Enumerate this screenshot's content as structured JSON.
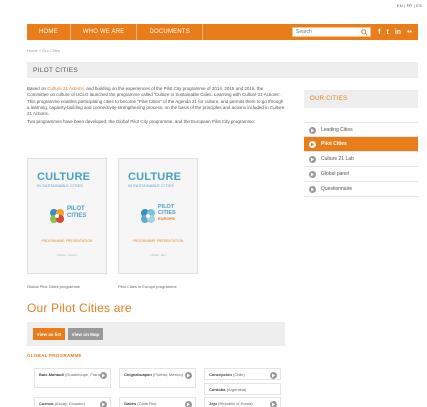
{
  "language_bar": "EN | FR | ES",
  "nav": {
    "items": [
      "HOME",
      "WHO WE ARE",
      "DOCUMENTS"
    ],
    "search_placeholder": "Search",
    "social": [
      "f",
      "t",
      "in",
      "••"
    ]
  },
  "breadcrumb": "Home > Our Cities",
  "page_title": "PILOT CITIES",
  "intro": {
    "p1_before": "Based on ",
    "p1_link": "Culture 21 Actions",
    "p1_after": ", and building on the experiences of the Pilot City programme of 2014, 2015 and 2016, the Committee on culture of UCLG launched the programme called 'Culture in Sustainable Cities. Learning with Culture 21 Actions'. This programme enables participating cities to become \"Pilot Cities\" of the Agenda 21 for culture, and permits them to go through a learning, capacity-building and connectivity-strengthening process, on the basis of the principles and actions included in Culture 21 Actions.",
    "p2": "Two programmes have been developed: the Global Pilot City programme, and the European Pilot City programme:"
  },
  "brochures": [
    {
      "title1": "CULTURE",
      "title2": "IN SUSTAINABLE CITIES",
      "logo_line1": "PILOT",
      "logo_line2": "CITIES",
      "logo_line3": "",
      "subtitle": "PROGRAMME PRESENTATION",
      "tiny": "UCLG · CGLU",
      "caption": "Global Pilot Cities programme",
      "colors": [
        "#3b8fc3",
        "#f2a02a",
        "#8cc04a",
        "#d9463c"
      ]
    },
    {
      "title1": "CULTURE",
      "title2": "IN SUSTAINABLE CITIES",
      "logo_line1": "PILOT",
      "logo_line2": "CITIES",
      "logo_line3": "EUROPE",
      "subtitle": "PROGRAMME PRESENTATION",
      "tiny": "UCLG · EU",
      "caption": "Pilot Cities in Europe programme",
      "colors": [
        "#3b8fc3",
        "#7bc4d8",
        "#5fa8d3",
        "#a4d3e8"
      ]
    }
  ],
  "sidebar": {
    "heading": "OUR CITIES",
    "items": [
      {
        "label": "Leading Cities",
        "active": false
      },
      {
        "label": "Pilot Cities",
        "active": true
      },
      {
        "label": "Culture 21 Lab",
        "active": false
      },
      {
        "label": "Global panel",
        "active": false
      },
      {
        "label": "Questionnaire",
        "active": false
      }
    ]
  },
  "section_title": "Our Pilot Cities are",
  "view_buttons": {
    "list": "View as list",
    "map": "View on Map"
  },
  "global_programme": "GLOBAL PROGRAMME",
  "cities": [
    {
      "name": "Baie-Mahault",
      "country": "(Guadeloupe, France)"
    },
    {
      "name": "Chignahuapan",
      "country": "(Puebla, Mexico)"
    },
    {
      "name": "Concepción",
      "country": "(Chile)"
    },
    {
      "name": "Córdoba",
      "country": "(Argentina)"
    },
    {
      "name": "Cuenca",
      "country": "(Azuay, Ecuador)"
    },
    {
      "name": "Gabès",
      "country": "(Chile-Rio)"
    },
    {
      "name": "Jeju",
      "country": "(Republic of Korea)"
    }
  ]
}
